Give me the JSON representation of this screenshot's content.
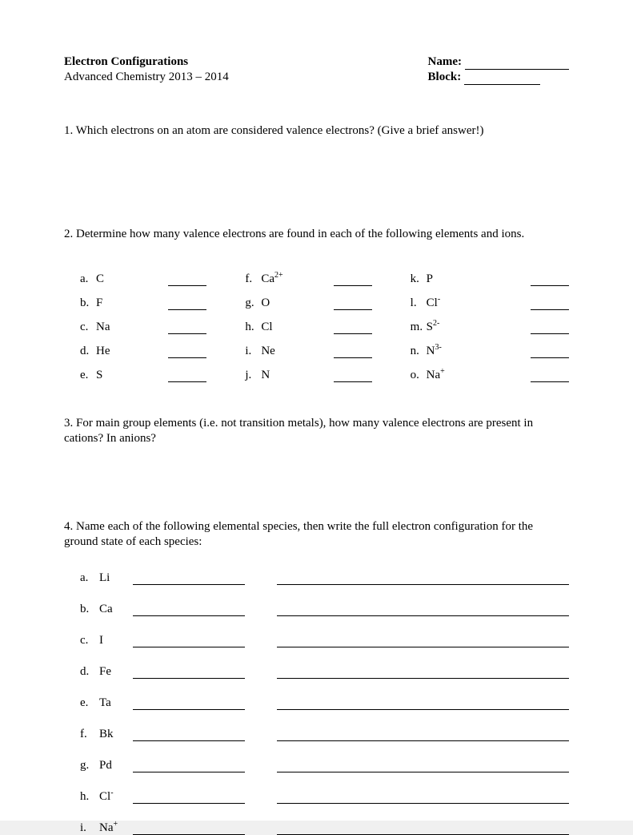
{
  "header": {
    "title": "Electron Configurations",
    "course": "Advanced Chemistry 2013 – 2014",
    "name_label": "Name:",
    "block_label": "Block:"
  },
  "q1": {
    "text": "1. Which electrons on an atom are considered valence electrons? (Give a brief answer!)"
  },
  "q2": {
    "text": "2. Determine how many valence electrons are found in each of the following elements and ions.",
    "items": [
      {
        "letter": "a.",
        "sym": "C",
        "sup": ""
      },
      {
        "letter": "b.",
        "sym": "F",
        "sup": ""
      },
      {
        "letter": "c.",
        "sym": "Na",
        "sup": ""
      },
      {
        "letter": "d.",
        "sym": "He",
        "sup": ""
      },
      {
        "letter": "e.",
        "sym": "S",
        "sup": ""
      },
      {
        "letter": "f.",
        "sym": "Ca",
        "sup": "2+"
      },
      {
        "letter": "g.",
        "sym": "O",
        "sup": ""
      },
      {
        "letter": "h.",
        "sym": "Cl",
        "sup": ""
      },
      {
        "letter": "i.",
        "sym": "Ne",
        "sup": ""
      },
      {
        "letter": "j.",
        "sym": "N",
        "sup": ""
      },
      {
        "letter": "k.",
        "sym": "P",
        "sup": ""
      },
      {
        "letter": "l.",
        "sym": "Cl",
        "sup": "-"
      },
      {
        "letter": "m.",
        "sym": "S",
        "sup": "2-"
      },
      {
        "letter": "n.",
        "sym": "N",
        "sup": "3-"
      },
      {
        "letter": "o.",
        "sym": "Na",
        "sup": "+"
      }
    ]
  },
  "q3": {
    "text": "3. For main group elements (i.e. not transition metals), how many valence electrons are present in cations?  In anions?"
  },
  "q4": {
    "text": "4. Name each of the following elemental species, then write the full electron configuration for the ground state of each species:",
    "items": [
      {
        "letter": "a.",
        "sym": "Li",
        "sup": ""
      },
      {
        "letter": "b.",
        "sym": "Ca",
        "sup": ""
      },
      {
        "letter": "c.",
        "sym": "I",
        "sup": ""
      },
      {
        "letter": "d.",
        "sym": "Fe",
        "sup": ""
      },
      {
        "letter": "e.",
        "sym": "Ta",
        "sup": ""
      },
      {
        "letter": "f.",
        "sym": "Bk",
        "sup": ""
      },
      {
        "letter": "g.",
        "sym": "Pd",
        "sup": ""
      },
      {
        "letter": "h.",
        "sym": "Cl",
        "sup": "-"
      },
      {
        "letter": "i.",
        "sym": "Na",
        "sup": "+"
      }
    ]
  }
}
